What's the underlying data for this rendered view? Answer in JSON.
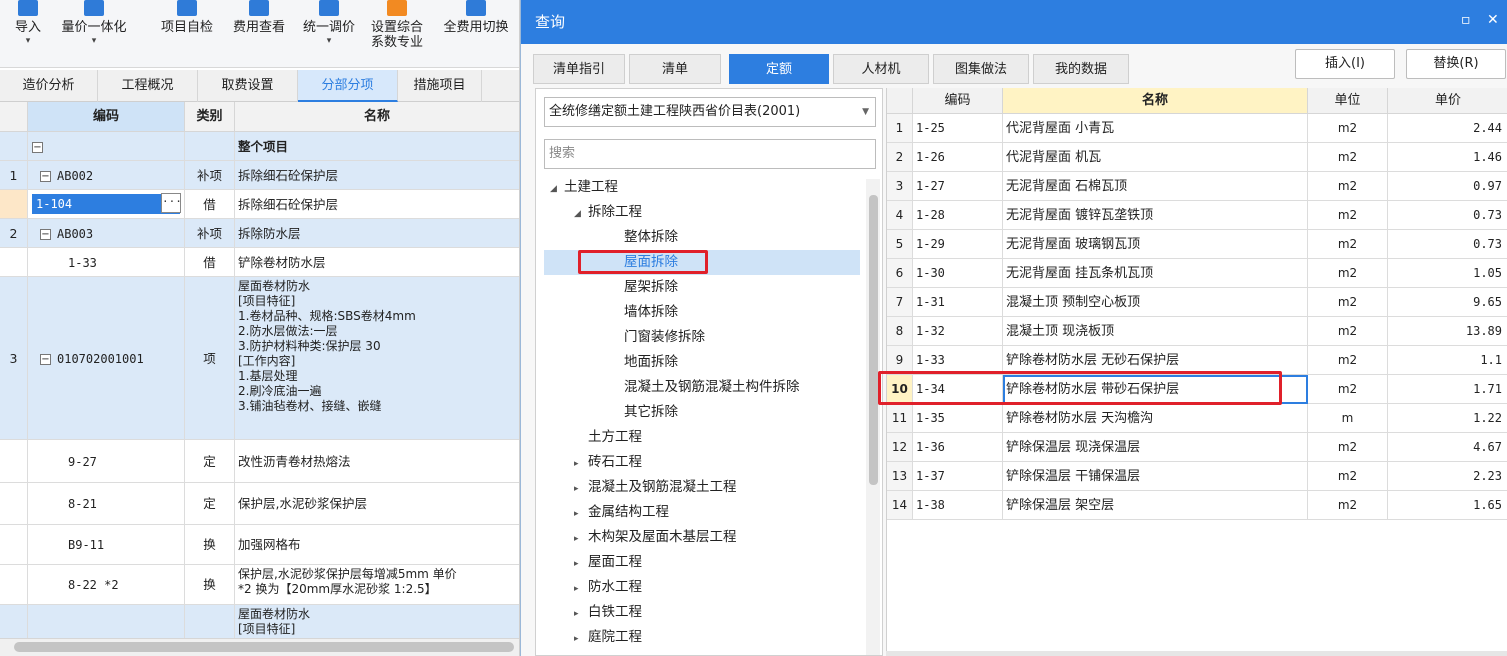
{
  "toolbar": {
    "buttons": [
      {
        "label": "导入",
        "icon": "import-icon",
        "dropdown": true
      },
      {
        "label": "量价一体化",
        "icon": "integrate-icon",
        "dropdown": true
      },
      {
        "label": "项目自检",
        "icon": "check-icon",
        "dropdown": false
      },
      {
        "label": "费用查看",
        "icon": "fee-view-icon",
        "dropdown": false
      },
      {
        "label": "统一调价",
        "icon": "adjust-price-icon",
        "dropdown": true
      },
      {
        "label": "设置综合",
        "label2": "系数专业",
        "icon": "percent-icon",
        "dropdown": false
      },
      {
        "label": "全费用切换",
        "icon": "switch-icon",
        "dropdown": false
      }
    ]
  },
  "view_tabs": [
    "造价分析",
    "工程概况",
    "取费设置",
    "分部分项",
    "措施项目"
  ],
  "grid": {
    "headers": {
      "code": "编码",
      "type": "类别",
      "name": "名称"
    },
    "rows": [
      {
        "row": "",
        "code": "",
        "type": "",
        "name": "整个项目"
      },
      {
        "row": "1",
        "code": "AB002",
        "type": "补项",
        "name": "拆除细石砼保护层"
      },
      {
        "row": "",
        "code": "1-104",
        "type": "借",
        "name": "拆除细石砼保护层"
      },
      {
        "row": "2",
        "code": "AB003",
        "type": "补项",
        "name": "拆除防水层"
      },
      {
        "row": "",
        "code": "1-33",
        "type": "借",
        "name": "铲除卷材防水层"
      },
      {
        "row": "3",
        "code": "010702001001",
        "type": "项",
        "name_lines": [
          "屋面卷材防水",
          "[项目特征]",
          "1.卷材品种、规格:SBS卷材4mm",
          "2.防水层做法:一层",
          "3.防护材料种类:保护层 30",
          "[工作内容]",
          "1.基层处理",
          "2.刷冷底油一遍",
          "3.铺油毡卷材、接缝、嵌缝"
        ]
      },
      {
        "row": "",
        "code": "9-27",
        "type": "定",
        "name": "改性沥青卷材热熔法"
      },
      {
        "row": "",
        "code": "8-21",
        "type": "定",
        "name": "保护层,水泥砂浆保护层"
      },
      {
        "row": "",
        "code": "B9-11",
        "type": "换",
        "name": "加强网格布"
      },
      {
        "row": "",
        "code": "8-22 *2",
        "type": "换",
        "name_lines": [
          "保护层,水泥砂浆保护层每增减5mm  单价",
          "*2  换为【20mm厚水泥砂浆 1:2.5】"
        ]
      },
      {
        "row": "",
        "code": "",
        "type": "",
        "name_lines": [
          "屋面卷材防水",
          "[项目特征]"
        ]
      }
    ]
  },
  "dialog": {
    "title": "查询",
    "tabs": [
      "清单指引",
      "清单",
      "定额",
      "人材机",
      "图集做法",
      "我的数据"
    ],
    "active_tab": "定额",
    "insert_label": "插入(I)",
    "replace_label": "替换(R)",
    "library": "全统修缮定额土建工程陕西省价目表(2001)",
    "search_placeholder": "搜索",
    "tree": [
      {
        "label": "土建工程",
        "level": 0,
        "arrow": "◢"
      },
      {
        "label": "拆除工程",
        "level": 1,
        "arrow": "◢"
      },
      {
        "label": "整体拆除",
        "level": 2,
        "arrow": ""
      },
      {
        "label": "屋面拆除",
        "level": 2,
        "arrow": "",
        "selected": true
      },
      {
        "label": "屋架拆除",
        "level": 2,
        "arrow": ""
      },
      {
        "label": "墙体拆除",
        "level": 2,
        "arrow": ""
      },
      {
        "label": "门窗装修拆除",
        "level": 2,
        "arrow": ""
      },
      {
        "label": "地面拆除",
        "level": 2,
        "arrow": ""
      },
      {
        "label": "混凝土及钢筋混凝土构件拆除",
        "level": 2,
        "arrow": ""
      },
      {
        "label": "其它拆除",
        "level": 2,
        "arrow": ""
      },
      {
        "label": "土方工程",
        "level": 1,
        "arrow": ""
      },
      {
        "label": "砖石工程",
        "level": 1,
        "arrow": "▸"
      },
      {
        "label": "混凝土及钢筋混凝土工程",
        "level": 1,
        "arrow": "▸"
      },
      {
        "label": "金属结构工程",
        "level": 1,
        "arrow": "▸"
      },
      {
        "label": "木构架及屋面木基层工程",
        "level": 1,
        "arrow": "▸"
      },
      {
        "label": "屋面工程",
        "level": 1,
        "arrow": "▸"
      },
      {
        "label": "防水工程",
        "level": 1,
        "arrow": "▸"
      },
      {
        "label": "白铁工程",
        "level": 1,
        "arrow": "▸"
      },
      {
        "label": "庭院工程",
        "level": 1,
        "arrow": "▸"
      }
    ],
    "table": {
      "headers": {
        "code": "编码",
        "name": "名称",
        "unit": "单位",
        "price": "单价"
      },
      "rows": [
        {
          "n": "1",
          "code": "1-25",
          "name": "代泥背屋面 小青瓦",
          "unit": "m2",
          "price": "2.44"
        },
        {
          "n": "2",
          "code": "1-26",
          "name": "代泥背屋面 机瓦",
          "unit": "m2",
          "price": "1.46"
        },
        {
          "n": "3",
          "code": "1-27",
          "name": "无泥背屋面 石棉瓦顶",
          "unit": "m2",
          "price": "0.97"
        },
        {
          "n": "4",
          "code": "1-28",
          "name": "无泥背屋面 镀锌瓦垄铁顶",
          "unit": "m2",
          "price": "0.73"
        },
        {
          "n": "5",
          "code": "1-29",
          "name": "无泥背屋面 玻璃钢瓦顶",
          "unit": "m2",
          "price": "0.73"
        },
        {
          "n": "6",
          "code": "1-30",
          "name": "无泥背屋面 挂瓦条机瓦顶",
          "unit": "m2",
          "price": "1.05"
        },
        {
          "n": "7",
          "code": "1-31",
          "name": "混凝土顶 预制空心板顶",
          "unit": "m2",
          "price": "9.65"
        },
        {
          "n": "8",
          "code": "1-32",
          "name": "混凝土顶 现浇板顶",
          "unit": "m2",
          "price": "13.89"
        },
        {
          "n": "9",
          "code": "1-33",
          "name": "铲除卷材防水层 无砂石保护层",
          "unit": "m2",
          "price": "1.1"
        },
        {
          "n": "10",
          "code": "1-34",
          "name": "铲除卷材防水层 带砂石保护层",
          "unit": "m2",
          "price": "1.71",
          "selected": true
        },
        {
          "n": "11",
          "code": "1-35",
          "name": "铲除卷材防水层 天沟檐沟",
          "unit": "m",
          "price": "1.22"
        },
        {
          "n": "12",
          "code": "1-36",
          "name": "铲除保温层 现浇保温层",
          "unit": "m2",
          "price": "4.67"
        },
        {
          "n": "13",
          "code": "1-37",
          "name": "铲除保温层 干铺保温层",
          "unit": "m2",
          "price": "2.23"
        },
        {
          "n": "14",
          "code": "1-38",
          "name": "铲除保温层 架空层",
          "unit": "m2",
          "price": "1.65"
        }
      ]
    }
  },
  "colors": {
    "accent": "#2d7ee0",
    "highlight_red": "#e0202a"
  }
}
